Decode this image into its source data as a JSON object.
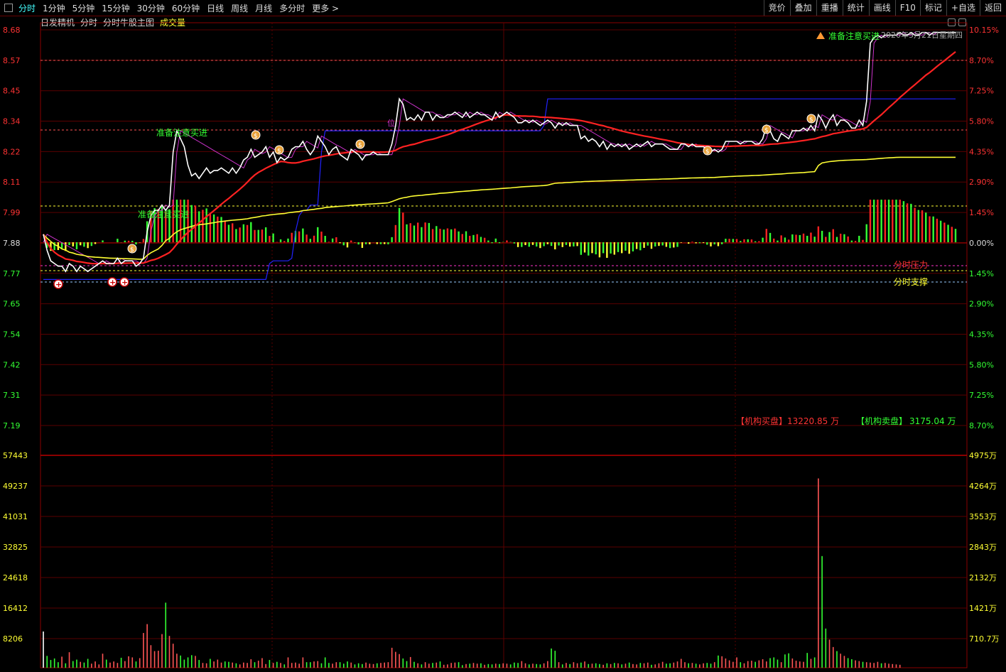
{
  "toolbar": {
    "tabs": [
      "分时",
      "1分钟",
      "5分钟",
      "15分钟",
      "30分钟",
      "60分钟",
      "日线",
      "周线",
      "月线",
      "多分时",
      "更多 >"
    ],
    "active_tab": "分时",
    "right_buttons": [
      "竞价",
      "叠加",
      "重播",
      "统计",
      "画线",
      "F10",
      "标记",
      "+自选",
      "返回"
    ]
  },
  "subtitle": {
    "name": "日发精机",
    "mode": "分时",
    "indicator": "分时牛股主图",
    "volume_label": "成交量"
  },
  "colors": {
    "up": "#ff3333",
    "down": "#33ff33",
    "price_line": "#ffffff",
    "avg_line": "#ffff33",
    "red_ma": "#ff2222",
    "blue_line": "#2222ff",
    "magenta_line": "#cc33cc",
    "grid": "#5a0000"
  },
  "price_axis": {
    "left_labels": [
      "8.68",
      "8.57",
      "8.45",
      "8.34",
      "8.22",
      "8.11",
      "7.99",
      "7.88",
      "7.77",
      "7.65",
      "7.54",
      "7.42",
      "7.31",
      "7.19"
    ],
    "right_labels": [
      "10.15%",
      "8.70%",
      "7.25%",
      "5.80%",
      "4.35%",
      "2.90%",
      "1.45%",
      "0.00%",
      "1.45%",
      "2.90%",
      "4.35%",
      "5.80%",
      "7.25%",
      "8.70%"
    ]
  },
  "volume_axis": {
    "left_labels": [
      "57443",
      "49237",
      "41031",
      "32825",
      "24618",
      "16412",
      "8206"
    ],
    "right_labels": [
      "4975万",
      "4264万",
      "3553万",
      "2843万",
      "2132万",
      "1421万",
      "710.7万"
    ]
  },
  "annotations": {
    "signal_text": "准备注意买进",
    "top_signal_text": "准备注意买进",
    "date_text": "2020年5月21日星期四",
    "resistance_label": "分时压力",
    "support_label": "分时支撑",
    "inst_buy_label": "【机构买盘】",
    "inst_buy_value": "13220.85 万",
    "inst_sell_label": "【机构卖盘】",
    "inst_sell_value": "3175.04 万",
    "magenta_marker": "位"
  },
  "chart_data": {
    "type": "line",
    "ylim": [
      7.19,
      8.68
    ],
    "prev_close": 7.88,
    "series": [
      {
        "name": "price",
        "values": [
          7.91,
          7.85,
          7.81,
          7.8,
          7.79,
          7.79,
          7.77,
          7.8,
          7.79,
          7.77,
          7.79,
          7.78,
          7.77,
          7.78,
          7.79,
          7.8,
          7.81,
          7.8,
          7.8,
          7.8,
          7.82,
          7.8,
          7.81,
          7.81,
          7.81,
          7.79,
          7.8,
          7.82,
          7.92,
          7.98,
          8.0,
          8.0,
          8.02,
          8.0,
          8.02,
          8.22,
          8.3,
          8.27,
          8.24,
          8.17,
          8.13,
          8.14,
          8.12,
          8.14,
          8.16,
          8.14,
          8.15,
          8.15,
          8.16,
          8.15,
          8.14,
          8.16,
          8.14,
          8.16,
          8.19,
          8.2,
          8.23,
          8.2,
          8.21,
          8.22,
          8.24,
          8.2,
          8.22,
          8.18,
          8.2,
          8.19,
          8.2,
          8.23,
          8.24,
          8.24,
          8.26,
          8.23,
          8.21,
          8.23,
          8.28,
          8.26,
          8.24,
          8.21,
          8.23,
          8.24,
          8.21,
          8.2,
          8.19,
          8.23,
          8.22,
          8.21,
          8.19,
          8.21,
          8.21,
          8.22,
          8.21,
          8.21,
          8.21,
          8.21,
          8.25,
          8.32,
          8.42,
          8.4,
          8.34,
          8.35,
          8.34,
          8.36,
          8.34,
          8.37,
          8.37,
          8.34,
          8.36,
          8.35,
          8.35,
          8.36,
          8.36,
          8.37,
          8.36,
          8.35,
          8.37,
          8.35,
          8.36,
          8.37,
          8.36,
          8.36,
          8.35,
          8.34,
          8.37,
          8.35,
          8.36,
          8.37,
          8.36,
          8.35,
          8.33,
          8.33,
          8.34,
          8.33,
          8.34,
          8.33,
          8.32,
          8.33,
          8.34,
          8.33,
          8.31,
          8.33,
          8.32,
          8.33,
          8.32,
          8.32,
          8.32,
          8.27,
          8.28,
          8.26,
          8.27,
          8.26,
          8.24,
          8.26,
          8.23,
          8.25,
          8.24,
          8.25,
          8.24,
          8.25,
          8.23,
          8.24,
          8.25,
          8.24,
          8.25,
          8.26,
          8.24,
          8.25,
          8.25,
          8.25,
          8.24,
          8.23,
          8.23,
          8.23,
          8.25,
          8.25,
          8.24,
          8.25,
          8.24,
          8.24,
          8.24,
          8.23,
          8.22,
          8.23,
          8.22,
          8.23,
          8.26,
          8.26,
          8.26,
          8.26,
          8.25,
          8.26,
          8.26,
          8.26,
          8.25,
          8.25,
          8.27,
          8.32,
          8.3,
          8.27,
          8.26,
          8.29,
          8.28,
          8.27,
          8.3,
          8.3,
          8.3,
          8.31,
          8.3,
          8.32,
          8.3,
          8.36,
          8.34,
          8.31,
          8.34,
          8.36,
          8.32,
          8.34,
          8.34,
          8.33,
          8.31,
          8.31,
          8.34,
          8.32,
          8.41,
          8.63,
          8.65,
          8.66,
          8.65,
          8.66,
          8.66,
          8.66,
          8.66,
          8.67,
          8.66,
          8.66,
          8.67,
          8.66,
          8.66,
          8.67,
          8.67,
          8.66,
          8.67,
          8.67,
          8.67,
          8.67,
          8.67,
          8.67,
          8.67
        ]
      },
      {
        "name": "avg",
        "values": []
      },
      {
        "name": "volume",
        "values": [
          9800,
          3200,
          2100,
          2500,
          1500,
          3000,
          1200,
          4200,
          1800,
          2200,
          1600,
          1400,
          2400,
          1100,
          1700,
          900,
          3800,
          2200,
          1400,
          1700,
          1300,
          2700,
          1800,
          3100,
          2800,
          1700,
          2600,
          9400,
          11800,
          6100,
          4500,
          4600,
          9100,
          17600,
          8600,
          6500,
          3800,
          3300,
          2200,
          2800,
          3400,
          3200,
          2100,
          1300,
          1200,
          2400,
          1700,
          2200,
          1400,
          1700,
          1600,
          1400,
          1200,
          900,
          1400,
          1300,
          2300,
          1500,
          1900,
          2600,
          1000,
          2100,
          1300,
          1600,
          1300,
          900,
          2800,
          1300,
          1400,
          1100,
          2800,
          1500,
          1500,
          1700,
          1800,
          1200,
          2800,
          1300,
          1100,
          1500,
          1500,
          1100,
          1700,
          1400,
          900,
          1200,
          1000,
          1400,
          1100,
          1000,
          1200,
          1300,
          1400,
          1500,
          5400,
          4300,
          3700,
          2500,
          1800,
          2900,
          1600,
          1200,
          900,
          1500,
          1100,
          1300,
          1400,
          1700,
          800,
          900,
          1300,
          1400,
          1500,
          700,
          1000,
          1100,
          1300,
          1100,
          1200,
          800,
          1000,
          900,
          1100,
          1000,
          1200,
          1100,
          900,
          1400,
          1300,
          1800,
          1200,
          900,
          1100,
          1000,
          900,
          1200,
          1800,
          5200,
          4600,
          1500,
          900,
          1300,
          1000,
          1500,
          1200,
          1400,
          1700,
          1000,
          1100,
          1200,
          1000,
          800,
          1200,
          1000,
          1300,
          1200,
          900,
          1100,
          1400,
          1000,
          900,
          1300,
          1200,
          1400,
          800,
          900,
          1200,
          1600,
          1100,
          1200,
          1400,
          1700,
          2400,
          1500,
          1200,
          1300,
          1100,
          900,
          1200,
          1300,
          1100,
          1500,
          3300,
          3100,
          2500,
          2000,
          1600,
          2800,
          1500,
          1200,
          1800,
          1900,
          1600,
          2000,
          2300,
          1700,
          2600,
          2800,
          2200,
          1500,
          3600,
          3900,
          2500,
          1900,
          1700,
          1600,
          4000,
          2400,
          2800,
          51200,
          30200,
          10600,
          7600,
          5600,
          4500,
          3800,
          3200,
          2600,
          2300,
          2000,
          1800,
          1600,
          1500,
          1400,
          1300,
          1600,
          1200,
          1300,
          1100,
          1000,
          900,
          800
        ]
      }
    ]
  }
}
